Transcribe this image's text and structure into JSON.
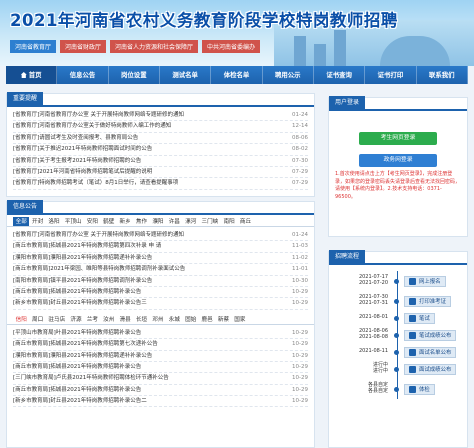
{
  "header": {
    "title": "2021年河南省农村义务教育阶段学校特岗教师招聘",
    "links": [
      "河南省教育厅",
      "河南省财政厅",
      "河南省人力资源和社会保障厅",
      "中共河南省委编办"
    ]
  },
  "nav": {
    "items": [
      "首页",
      "信息公告",
      "岗位设置",
      "测试名单",
      "体检名单",
      "聘用公示",
      "证书查询",
      "证书打印",
      "联系我们"
    ]
  },
  "important": {
    "title": "重要提醒",
    "items": [
      {
        "text": "[省教育厅]河南省教育厅办公室 关于开展特岗教师网络专题研修的通知",
        "date": "01-24"
      },
      {
        "text": "[省教育厅]河南省教育厅办公室关于做好特岗教师入编工作的通知",
        "date": "12-14"
      },
      {
        "text": "[省教育厅]请圆试考生及时查阅报考、县教育局公告",
        "date": "08-06"
      },
      {
        "text": "[省教育厅]关于推迟2021年特岗教师招聘面试时间的公告",
        "date": "08-02"
      },
      {
        "text": "[省教育厅]关于考生报考2021年特岗教师招聘的公告",
        "date": "07-30"
      },
      {
        "text": "[省教育厅]2021年河南省特岗教师招聘笔试后提醒的说明",
        "date": "07-29"
      },
      {
        "text": "[省教育厅]特岗教师招聘考试（笔试）8月1日举行，请查看提醒事项",
        "date": "07-29"
      }
    ]
  },
  "info": {
    "title": "信息公告",
    "tabs": [
      "全部",
      "开封",
      "洛阳",
      "平顶山",
      "安阳",
      "鹤壁",
      "新乡",
      "焦作",
      "濮阳",
      "许昌",
      "漯河",
      "三门峡",
      "南阳",
      "商丘"
    ],
    "items": [
      {
        "text": "[省教育厅]河南省教育厅办公室 关于开展特岗教师网络专题研修的通知",
        "date": "01-24"
      },
      {
        "text": "[商丘市教育局]拓城县2021年特岗教师招聘第四次补录 申 请",
        "date": "11-03"
      },
      {
        "text": "[濮阳市教育局]濮阳县2021年特岗教师招聘递补补录公告",
        "date": "11-02"
      },
      {
        "text": "[商丘市教育局]2021年梁园、睢阳等县特岗教师招聘调剂补录面试公告",
        "date": "11-01"
      },
      {
        "text": "[南阳市教育局]镇平县2021年特岗教师招聘调剂补录公告",
        "date": "10-30"
      },
      {
        "text": "[商丘市教育局]拓城县2021年特岗教师招聘补录公告",
        "date": "10-29"
      },
      {
        "text": "[新乡市教育局]封丘县2021年特岗教师招聘补录公告三",
        "date": "10-29"
      }
    ],
    "tabs2": [
      "信阳",
      "周口",
      "驻马店",
      "济源",
      "兰考",
      "汝州",
      "滑县",
      "长垣",
      "邓州",
      "永城",
      "固始",
      "鹿邑",
      "新蔡",
      "国家"
    ],
    "items2": [
      {
        "text": "[平顶山市教育局]叶县2021年特岗教师招聘补录公告",
        "date": "10-29"
      },
      {
        "text": "[商丘市教育局]拓城县2021年特岗教师招聘第七次递补公告",
        "date": "10-29"
      },
      {
        "text": "[濮阳市教育局]濮阳县2021年特岗教师招聘递补补录公告",
        "date": "10-29"
      },
      {
        "text": "[商丘市教育局]拓城县2021年特岗教师招聘补录公告",
        "date": "10-29"
      },
      {
        "text": "[三门峡市教育局]卢氏县2021年特岗教师招聘体检环节通补公告",
        "date": "10-29"
      },
      {
        "text": "[商丘市教育局]拓城县2021年特岗教师招聘补录公告",
        "date": "10-29"
      },
      {
        "text": "[新乡市教育局]封丘县2021年特岗教师招聘补录公告二",
        "date": "10-29"
      }
    ]
  },
  "login": {
    "title": "用户登录",
    "examinee_button": "考生网页登录",
    "admin_button": "政务网登录",
    "note": "1.首次使用请点击上方【考生网页登录】，完成注册登录，如果您的登录密码丢失请登录后查看无法找回密码，请使用【系统内登录】。2.技术支持电话：0371-96500。"
  },
  "process": {
    "title": "招聘流程",
    "steps": [
      {
        "date": "2021-07-17\n2021-07-20",
        "label": "网上报名"
      },
      {
        "date": "2021-07-30\n2021-07-31",
        "label": "打印准考证"
      },
      {
        "date": "2021-08-01",
        "label": "笔试"
      },
      {
        "date": "2021-08-06\n2021-08-08",
        "label": "笔试成绩公布"
      },
      {
        "date": "2021-08-11",
        "label": "面试名单公布"
      },
      {
        "date": "进行中\n进行中",
        "label": "面试成绩公布"
      },
      {
        "date": "各县自定\n各县自定",
        "label": "体检"
      }
    ]
  },
  "colors": {
    "primary": "#1d62ad",
    "green": "#2cac4d",
    "red": "#d33333"
  }
}
